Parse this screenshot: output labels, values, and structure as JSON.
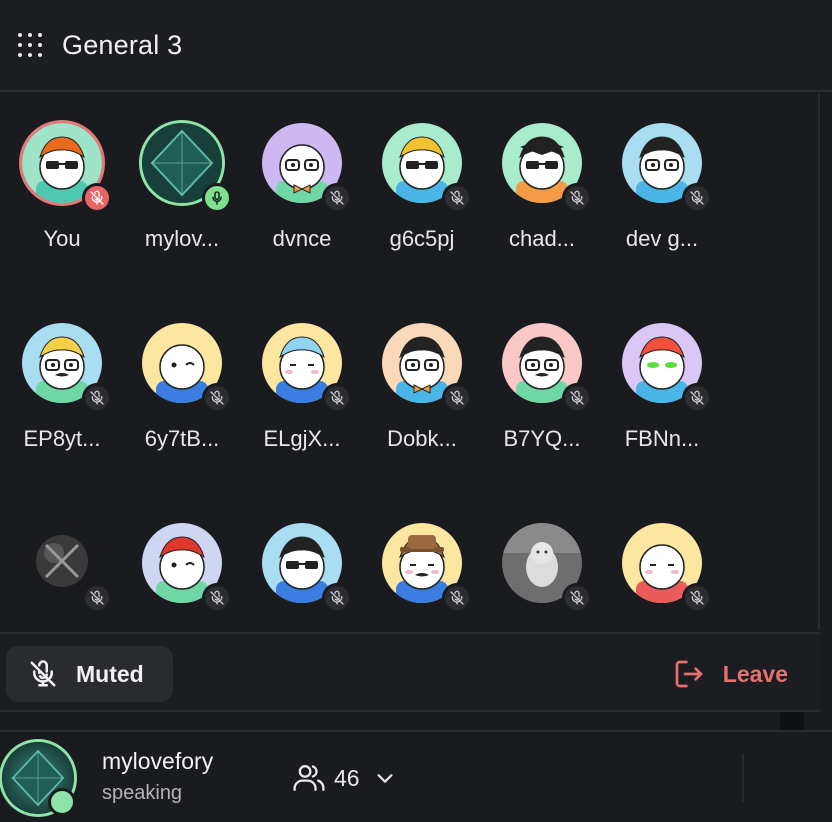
{
  "header": {
    "title": "General 3"
  },
  "participants": [
    {
      "name": "You",
      "mic": "muted-self",
      "ring": "red",
      "avatar": "orange-afro-sunglasses"
    },
    {
      "name": "mylov...",
      "mic": "speaking",
      "ring": "green",
      "avatar": "crystal-image"
    },
    {
      "name": "dvnce",
      "mic": "muted",
      "ring": "",
      "avatar": "glasses-bowtie"
    },
    {
      "name": "g6c5pj",
      "mic": "muted",
      "ring": "",
      "avatar": "beanie-sunglasses"
    },
    {
      "name": "chad...",
      "mic": "muted",
      "ring": "",
      "avatar": "graduation-cap-sunglasses"
    },
    {
      "name": "dev g...",
      "mic": "muted",
      "ring": "",
      "avatar": "topknot-glasses"
    },
    {
      "name": "EP8yt...",
      "mic": "muted",
      "ring": "",
      "avatar": "cap-glasses-mustache"
    },
    {
      "name": "6y7tB...",
      "mic": "muted",
      "ring": "",
      "avatar": "winking"
    },
    {
      "name": "ELgjX...",
      "mic": "muted",
      "ring": "",
      "avatar": "blue-hair-sad"
    },
    {
      "name": "Dobk...",
      "mic": "muted",
      "ring": "",
      "avatar": "spiky-glasses-bowtie"
    },
    {
      "name": "B7YQ...",
      "mic": "muted",
      "ring": "",
      "avatar": "topknot-glasses-mustache"
    },
    {
      "name": "FBNn...",
      "mic": "muted",
      "ring": "",
      "avatar": "red-hair-green-eyes"
    },
    {
      "name": "",
      "mic": "muted",
      "ring": "",
      "avatar": "dark-sphere"
    },
    {
      "name": "",
      "mic": "muted",
      "ring": "",
      "avatar": "red-cap-winking"
    },
    {
      "name": "",
      "mic": "muted",
      "ring": "",
      "avatar": "spiky-sunglasses"
    },
    {
      "name": "",
      "mic": "muted",
      "ring": "",
      "avatar": "fedora-mustache"
    },
    {
      "name": "",
      "mic": "muted",
      "ring": "",
      "avatar": "white-cat-photo"
    },
    {
      "name": "",
      "mic": "muted",
      "ring": "",
      "avatar": "sad-blush"
    }
  ],
  "controls": {
    "muted_label": "Muted",
    "leave_label": "Leave"
  },
  "footer": {
    "name": "mylovefory",
    "status": "speaking",
    "count": "46"
  },
  "colors": {
    "accent_red": "#e8706f",
    "speaking_green": "#8fe3a8",
    "background": "#1a1b1e"
  }
}
